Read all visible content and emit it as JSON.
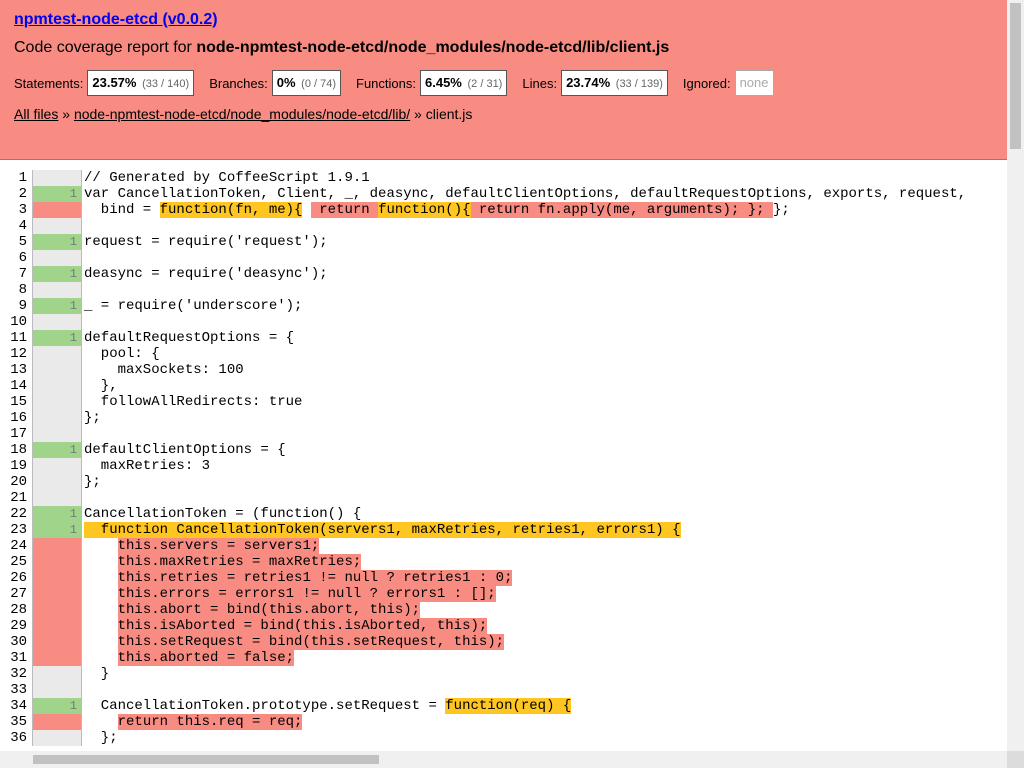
{
  "header": {
    "title": "npmtest-node-etcd (v0.0.2)",
    "subtitle_prefix": "Code coverage report for ",
    "subtitle_path": "node-npmtest-node-etcd/node_modules/node-etcd/lib/client.js",
    "stats": [
      {
        "label": "Statements:",
        "pct": "23.57%",
        "frac": "(33 / 140)"
      },
      {
        "label": "Branches:",
        "pct": "0%",
        "frac": "(0 / 74)"
      },
      {
        "label": "Functions:",
        "pct": "6.45%",
        "frac": "(2 / 31)"
      },
      {
        "label": "Lines:",
        "pct": "23.74%",
        "frac": "(33 / 139)"
      }
    ],
    "ignored_label": "Ignored:",
    "ignored_value": "none",
    "breadcrumb": {
      "all_files": "All files",
      "sep1": " » ",
      "dir": "node-npmtest-node-etcd/node_modules/node-etcd/lib/",
      "sep2": " » ",
      "file": "client.js"
    }
  },
  "colors": {
    "header_bg": "#f88c82",
    "covered": "#a0d48b",
    "uncovered": "#f88c82",
    "fn_uncovered": "#ffc520"
  },
  "lines": [
    {
      "n": "1",
      "cov": "",
      "state": "none",
      "segs": [
        {
          "t": "// Generated by CoffeeScript 1.9.1"
        }
      ]
    },
    {
      "n": "2",
      "cov": "1",
      "state": "yes",
      "segs": [
        {
          "t": "var CancellationToken, Client, _, deasync, defaultClientOptions, defaultRequestOptions, exports, request,"
        }
      ]
    },
    {
      "n": "3",
      "cov": "",
      "state": "no",
      "segs": [
        {
          "t": "  bind = "
        },
        {
          "t": "function(fn, me){",
          "h": "fn"
        },
        {
          "t": " "
        },
        {
          "t": " return ",
          "h": "st"
        },
        {
          "t": "function(){",
          "h": "fn"
        },
        {
          "t": " return fn.apply(me, arguments); }; ",
          "h": "st"
        },
        {
          "t": "};"
        }
      ]
    },
    {
      "n": "4",
      "cov": "",
      "state": "none",
      "segs": [
        {
          "t": ""
        }
      ]
    },
    {
      "n": "5",
      "cov": "1",
      "state": "yes",
      "segs": [
        {
          "t": "request = require('request');"
        }
      ]
    },
    {
      "n": "6",
      "cov": "",
      "state": "none",
      "segs": [
        {
          "t": ""
        }
      ]
    },
    {
      "n": "7",
      "cov": "1",
      "state": "yes",
      "segs": [
        {
          "t": "deasync = require('deasync');"
        }
      ]
    },
    {
      "n": "8",
      "cov": "",
      "state": "none",
      "segs": [
        {
          "t": ""
        }
      ]
    },
    {
      "n": "9",
      "cov": "1",
      "state": "yes",
      "segs": [
        {
          "t": "_ = require('underscore');"
        }
      ]
    },
    {
      "n": "10",
      "cov": "",
      "state": "none",
      "segs": [
        {
          "t": ""
        }
      ]
    },
    {
      "n": "11",
      "cov": "1",
      "state": "yes",
      "segs": [
        {
          "t": "defaultRequestOptions = {"
        }
      ]
    },
    {
      "n": "12",
      "cov": "",
      "state": "none",
      "segs": [
        {
          "t": "  pool: {"
        }
      ]
    },
    {
      "n": "13",
      "cov": "",
      "state": "none",
      "segs": [
        {
          "t": "    maxSockets: 100"
        }
      ]
    },
    {
      "n": "14",
      "cov": "",
      "state": "none",
      "segs": [
        {
          "t": "  },"
        }
      ]
    },
    {
      "n": "15",
      "cov": "",
      "state": "none",
      "segs": [
        {
          "t": "  followAllRedirects: true"
        }
      ]
    },
    {
      "n": "16",
      "cov": "",
      "state": "none",
      "segs": [
        {
          "t": "};"
        }
      ]
    },
    {
      "n": "17",
      "cov": "",
      "state": "none",
      "segs": [
        {
          "t": ""
        }
      ]
    },
    {
      "n": "18",
      "cov": "1",
      "state": "yes",
      "segs": [
        {
          "t": "defaultClientOptions = {"
        }
      ]
    },
    {
      "n": "19",
      "cov": "",
      "state": "none",
      "segs": [
        {
          "t": "  maxRetries: 3"
        }
      ]
    },
    {
      "n": "20",
      "cov": "",
      "state": "none",
      "segs": [
        {
          "t": "};"
        }
      ]
    },
    {
      "n": "21",
      "cov": "",
      "state": "none",
      "segs": [
        {
          "t": ""
        }
      ]
    },
    {
      "n": "22",
      "cov": "1",
      "state": "yes",
      "segs": [
        {
          "t": "CancellationToken = (function() {"
        }
      ]
    },
    {
      "n": "23",
      "cov": "1",
      "state": "yes",
      "segs": [
        {
          "t": "  function CancellationToken(servers1, maxRetries, retries1, errors1) {",
          "h": "fn"
        }
      ]
    },
    {
      "n": "24",
      "cov": "",
      "state": "no",
      "segs": [
        {
          "t": "    "
        },
        {
          "t": "this.servers = servers1;",
          "h": "st"
        }
      ]
    },
    {
      "n": "25",
      "cov": "",
      "state": "no",
      "segs": [
        {
          "t": "    "
        },
        {
          "t": "this.maxRetries = maxRetries;",
          "h": "st"
        }
      ]
    },
    {
      "n": "26",
      "cov": "",
      "state": "no",
      "segs": [
        {
          "t": "    "
        },
        {
          "t": "this.retries = retries1 != null ? retries1 : 0;",
          "h": "st"
        }
      ]
    },
    {
      "n": "27",
      "cov": "",
      "state": "no",
      "segs": [
        {
          "t": "    "
        },
        {
          "t": "this.errors = errors1 != null ? errors1 : [];",
          "h": "st"
        }
      ]
    },
    {
      "n": "28",
      "cov": "",
      "state": "no",
      "segs": [
        {
          "t": "    "
        },
        {
          "t": "this.abort = bind(this.abort, this);",
          "h": "st"
        }
      ]
    },
    {
      "n": "29",
      "cov": "",
      "state": "no",
      "segs": [
        {
          "t": "    "
        },
        {
          "t": "this.isAborted = bind(this.isAborted, this);",
          "h": "st"
        }
      ]
    },
    {
      "n": "30",
      "cov": "",
      "state": "no",
      "segs": [
        {
          "t": "    "
        },
        {
          "t": "this.setRequest = bind(this.setRequest, this);",
          "h": "st"
        }
      ]
    },
    {
      "n": "31",
      "cov": "",
      "state": "no",
      "segs": [
        {
          "t": "    "
        },
        {
          "t": "this.aborted = false;",
          "h": "st"
        }
      ]
    },
    {
      "n": "32",
      "cov": "",
      "state": "none",
      "segs": [
        {
          "t": "  }"
        }
      ]
    },
    {
      "n": "33",
      "cov": "",
      "state": "none",
      "segs": [
        {
          "t": ""
        }
      ]
    },
    {
      "n": "34",
      "cov": "1",
      "state": "yes",
      "segs": [
        {
          "t": "  CancellationToken.prototype.setRequest = "
        },
        {
          "t": "function(req) {",
          "h": "fn"
        }
      ]
    },
    {
      "n": "35",
      "cov": "",
      "state": "no",
      "segs": [
        {
          "t": "    "
        },
        {
          "t": "return this.req = req;",
          "h": "st"
        }
      ]
    },
    {
      "n": "36",
      "cov": "",
      "state": "none",
      "segs": [
        {
          "t": "  };"
        }
      ]
    }
  ]
}
